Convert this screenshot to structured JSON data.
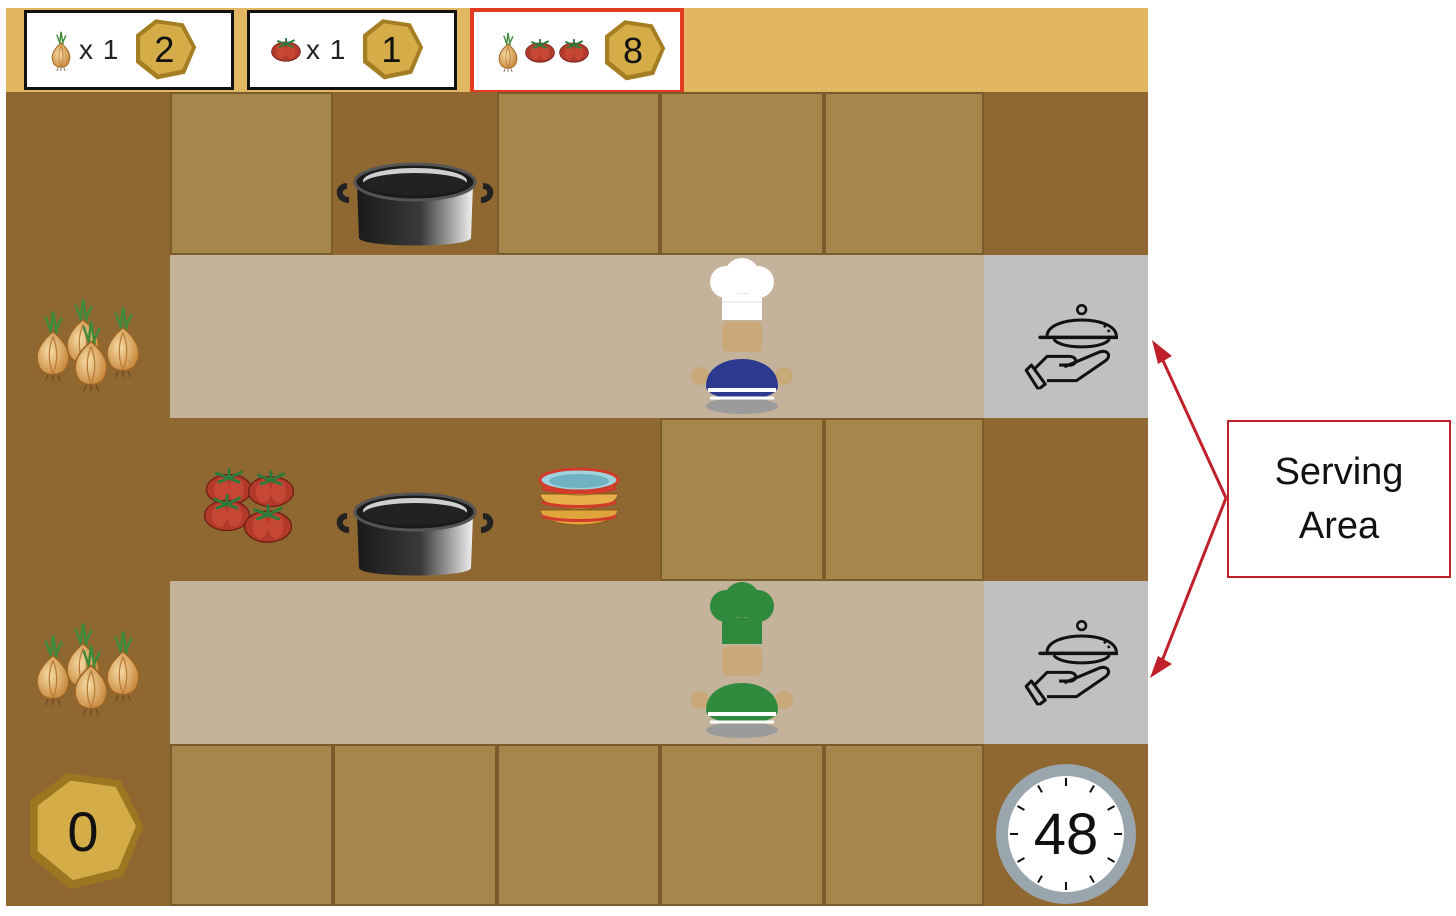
{
  "orders": [
    {
      "qty": "x 1",
      "reward": "2",
      "ingredients": [
        "onion"
      ],
      "highlighted": false
    },
    {
      "qty": "x 1",
      "reward": "1",
      "ingredients": [
        "tomato"
      ],
      "highlighted": false
    },
    {
      "qty": "",
      "reward": "8",
      "ingredients": [
        "onion",
        "tomato",
        "tomato"
      ],
      "highlighted": true
    }
  ],
  "hud": {
    "score": "0",
    "timer": "48"
  },
  "annotation": {
    "line1": "Serving",
    "line2": "Area"
  },
  "icons": {
    "onion": "onion-icon",
    "tomato": "tomato-icon",
    "pot": "pot-icon",
    "bowls": "bowl-stack-icon",
    "serve": "serving-cloche-icon",
    "chef": "chef-icon"
  },
  "colors": {
    "order_bar": "#e2b761",
    "counter": "#8f6731",
    "counter_tile": "#a5864b",
    "floor": "#c4b29a",
    "serving_area": "#c0c0c0",
    "coin": "#d4ad48",
    "highlight": "#e23b22",
    "annotation": "#c0202a",
    "chef_blue": "#2b3a8f",
    "chef_green": "#2f8a3e"
  }
}
